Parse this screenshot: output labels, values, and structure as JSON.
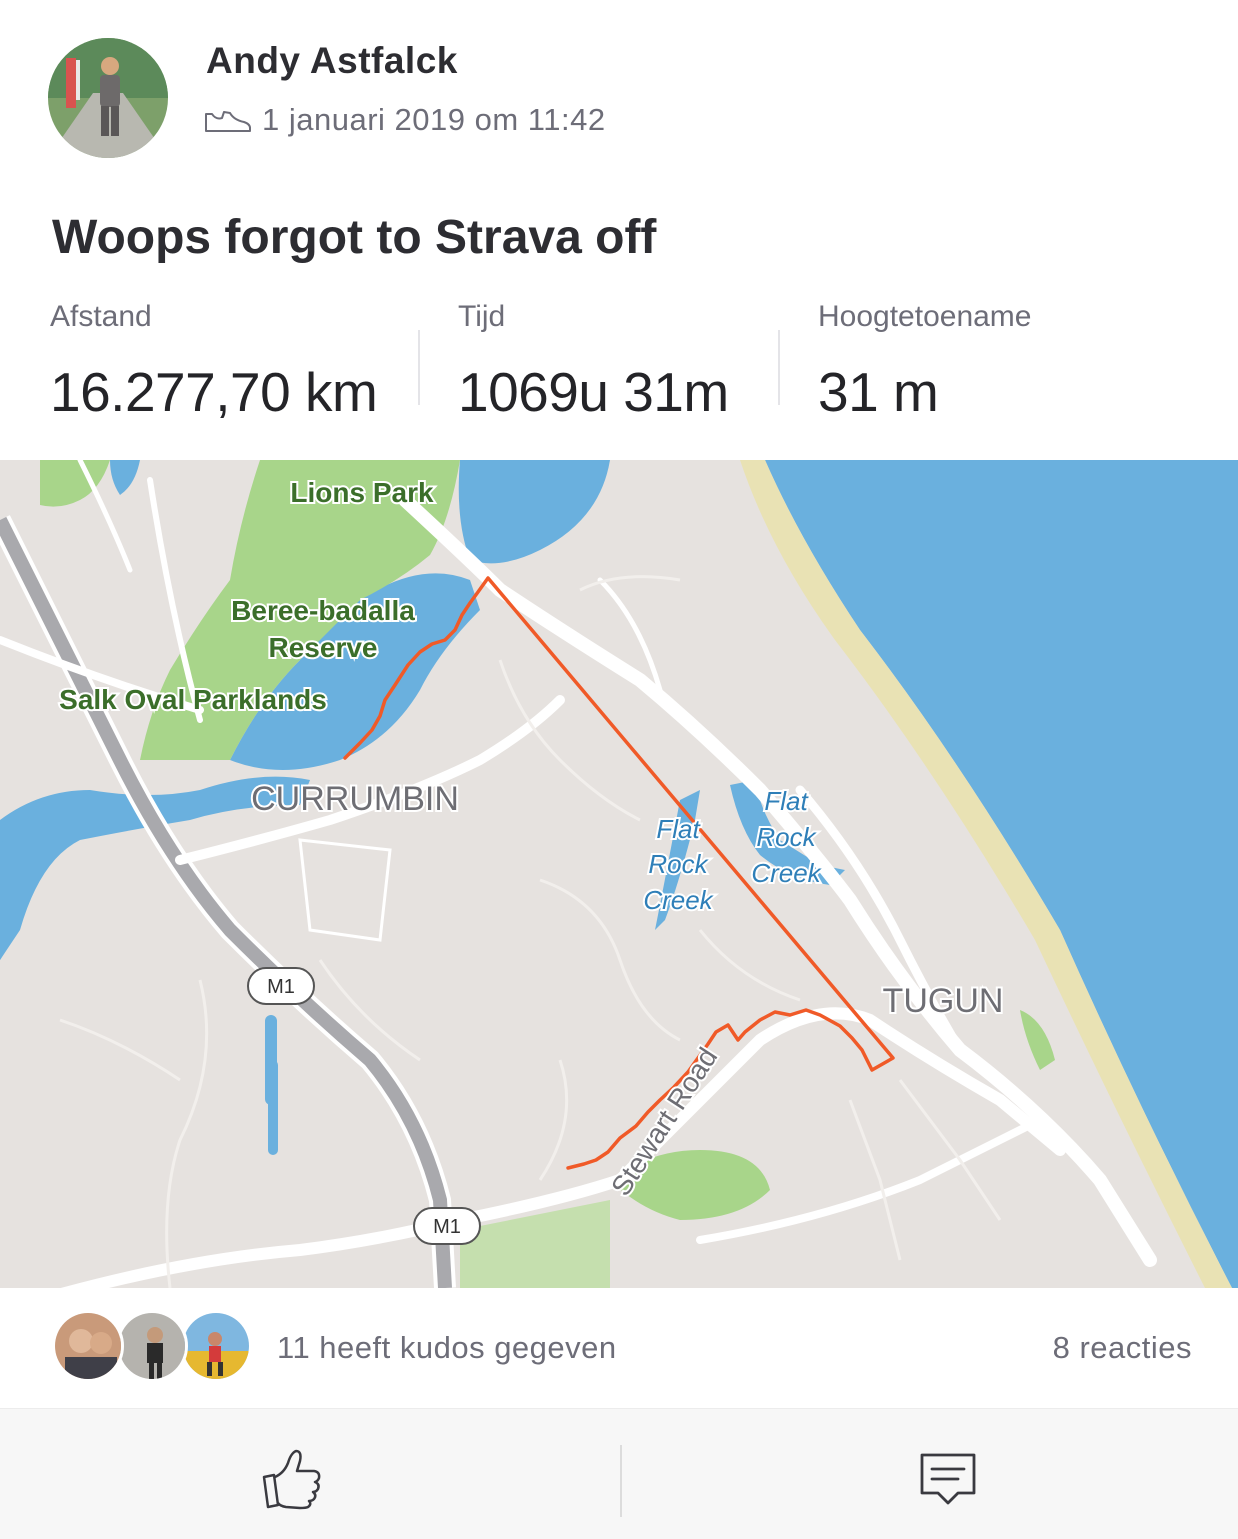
{
  "activity": {
    "author": "Andy Astfalck",
    "datetime": "1 januari 2019 om 11:42",
    "title": "Woops forgot to Strava off",
    "stats": [
      {
        "label": "Afstand",
        "value": "16.277,70 km"
      },
      {
        "label": "Tijd",
        "value": "1069u 31m"
      },
      {
        "label": "Hoogtetoename",
        "value": "31 m"
      }
    ]
  },
  "map": {
    "labels": {
      "lions_park": "Lions Park",
      "beree_1": "Beree-badalla",
      "beree_2": "Reserve",
      "salk": "Salk Oval Parklands",
      "currumbin": "CURRUMBIN",
      "flat1_a": "Flat",
      "flat1_b": "Rock",
      "flat1_c": "Creek",
      "flat2_a": "Flat",
      "flat2_b": "Rock",
      "flat2_c": "Creek",
      "tugun": "TUGUN",
      "stewart": "Stewart Road",
      "m1_a": "M1",
      "m1_b": "M1"
    },
    "colors": {
      "water": "#6ab0de",
      "land": "#e6e2df",
      "park": "#a8d58a",
      "route": "#f05a28",
      "beach": "#e9e2b4"
    }
  },
  "social": {
    "kudos_text": "11 heeft kudos gegeven",
    "comments_text": "8 reacties"
  },
  "icons": {
    "activity_type": "shoe-icon",
    "kudos": "thumbs-up-icon",
    "comment": "comment-icon"
  }
}
